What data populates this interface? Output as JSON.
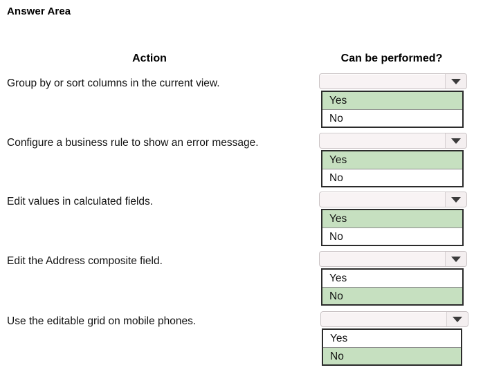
{
  "page": {
    "title": "Answer Area"
  },
  "headers": {
    "action": "Action",
    "answer": "Can be performed?"
  },
  "colors": {
    "selected_option_background": "#c6e0c0",
    "select_face_background": "#f8f3f4",
    "option_list_border": "#2b2b2b",
    "arrow_glyph": "#3b3b3b",
    "page_background": "#ffffff",
    "text": "#111111"
  },
  "icons": {
    "dropdown_arrow": "chevron-down-icon"
  },
  "dropdown_options": [
    "Yes",
    "No"
  ],
  "rows": [
    {
      "action": "Group by or sort columns in the current view.",
      "selected_value": "",
      "placeholder": "",
      "options": [
        {
          "label": "Yes",
          "selected": true
        },
        {
          "label": "No",
          "selected": false
        }
      ]
    },
    {
      "action": "Configure a business rule to show an error message.",
      "selected_value": "",
      "placeholder": "",
      "options": [
        {
          "label": "Yes",
          "selected": true
        },
        {
          "label": "No",
          "selected": false
        }
      ]
    },
    {
      "action": "Edit values in calculated fields.",
      "selected_value": "",
      "placeholder": "",
      "options": [
        {
          "label": "Yes",
          "selected": true
        },
        {
          "label": "No",
          "selected": false
        }
      ]
    },
    {
      "action": "Edit the Address composite field.",
      "selected_value": "",
      "placeholder": "",
      "options": [
        {
          "label": "Yes",
          "selected": false
        },
        {
          "label": "No",
          "selected": true
        }
      ]
    },
    {
      "action": "Use the editable grid on mobile phones.",
      "selected_value": "",
      "placeholder": "",
      "options": [
        {
          "label": "Yes",
          "selected": false
        },
        {
          "label": "No",
          "selected": true
        }
      ]
    }
  ]
}
